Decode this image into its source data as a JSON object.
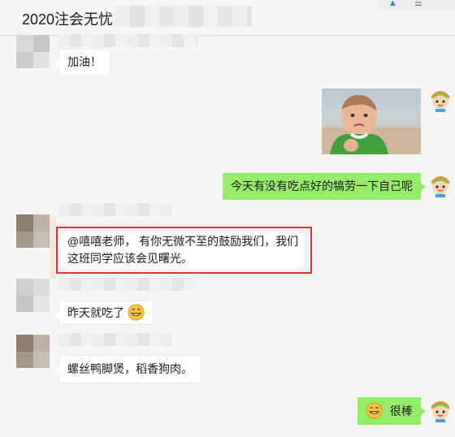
{
  "chat": {
    "title": "2020注会无忧"
  },
  "messages": [
    {
      "side": "left",
      "text": "加油！"
    },
    {
      "side": "right",
      "type": "image"
    },
    {
      "side": "right",
      "text": "今天有没有吃点好的犒劳一下自己呢"
    },
    {
      "side": "left",
      "lines": [
        "@嘻嘻老师， 有你无微不至的鼓励我们，我们",
        "这班同学应该会见曙光。"
      ],
      "highlighted": true
    },
    {
      "side": "left",
      "text": "昨天就吃了",
      "emoji": "grin-emoji"
    },
    {
      "side": "left",
      "text": "螺丝鸭脚煲，稻香狗肉。"
    },
    {
      "side": "right",
      "text": "很棒",
      "emoji": "grin-emoji"
    }
  ],
  "colors": {
    "self_bubble": "#95ec69",
    "other_bubble": "#ffffff",
    "highlight_border": "#e03131",
    "background": "#f5f5f5"
  }
}
